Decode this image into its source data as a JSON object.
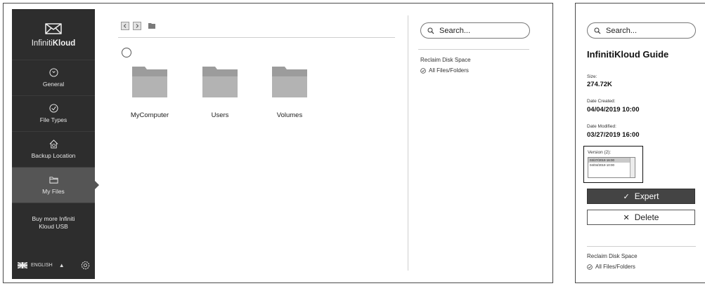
{
  "sidebar": {
    "brand_light": "Infiniti",
    "brand_bold": "Kloud",
    "items": [
      {
        "label": "General",
        "icon": "general-icon"
      },
      {
        "label": "File Types",
        "icon": "check-circle-icon"
      },
      {
        "label": "Backup Location",
        "icon": "home-search-icon"
      },
      {
        "label": "My Files",
        "icon": "folder-icon",
        "active": true
      },
      {
        "label_line1": "Buy more Infiniti",
        "label_line2": "Kloud USB"
      }
    ],
    "language": "ENGLISH"
  },
  "folders": [
    {
      "name": "MyComputer"
    },
    {
      "name": "Users"
    },
    {
      "name": "Volumes"
    }
  ],
  "search": {
    "placeholder": "Search..."
  },
  "reclaim": {
    "title": "Reclaim Disk Space",
    "option": "All Files/Folders"
  },
  "detail": {
    "title": "InfinitiKloud Guide",
    "size_label": "Size:",
    "size_value": "274.72K",
    "created_label": "Date Created:",
    "created_value": "04/04/2019 10:00",
    "modified_label": "Date Modified:",
    "modified_value": "03/27/2019 16:00",
    "version_label": "Version (2):",
    "versions": [
      "03/27/2019 16:00",
      "04/04/2019 10:00"
    ],
    "expert_label": "Expert",
    "delete_label": "Delete"
  },
  "colors": {
    "sidebar_bg": "#2d2d2d",
    "sidebar_active": "#555555",
    "expert_button": "#444444"
  }
}
